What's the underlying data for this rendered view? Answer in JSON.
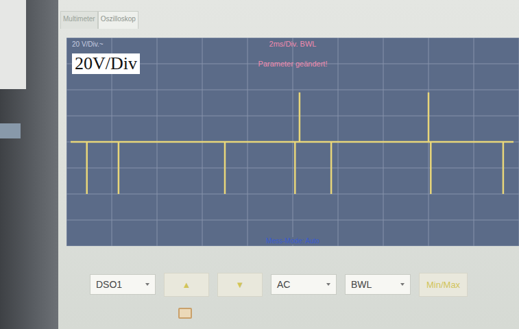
{
  "tabs": [
    {
      "label": "Multimeter",
      "selected": false
    },
    {
      "label": "Oszilloskop",
      "selected": true
    }
  ],
  "scope": {
    "scale_label": "20 V/Div.~",
    "timebase_label": "2ms/Div. BWL",
    "notice": "Parameter geändert!",
    "annotation": "20V/Div",
    "mode": "Mess-Mode: Auto",
    "trace": {
      "times_ms": [
        0.9,
        2.3,
        7.0,
        10.1,
        10.3,
        11.7,
        16.0,
        16.1,
        19.3
      ],
      "volts": [
        -40,
        -40,
        -40,
        -40,
        38,
        -40,
        38,
        -40,
        -40
      ]
    }
  },
  "controls": [
    {
      "kind": "dropdown",
      "label": "DSO1",
      "disabled": false
    },
    {
      "kind": "button",
      "label": "▲",
      "disabled": true
    },
    {
      "kind": "button",
      "label": "▼",
      "disabled": true
    },
    {
      "kind": "dropdown",
      "label": "AC",
      "disabled": false
    },
    {
      "kind": "dropdown",
      "label": "BWL",
      "disabled": false
    },
    {
      "kind": "button",
      "label": "Min/Max",
      "disabled": true
    }
  ]
}
